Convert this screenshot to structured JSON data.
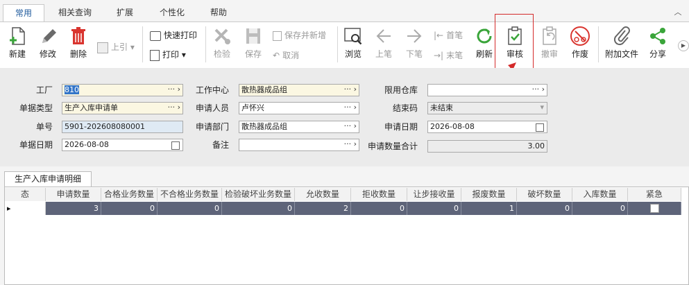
{
  "menu_tabs": [
    "常用",
    "相关查询",
    "扩展",
    "个性化",
    "帮助"
  ],
  "toolbar": {
    "new": "新建",
    "edit": "修改",
    "delete": "删除",
    "pull": "上引",
    "quick_print": "快速打印",
    "print": "打印",
    "inspect": "检验",
    "save": "保存",
    "save_new": "保存并新增",
    "cancel": "取消",
    "browse": "浏览",
    "prev": "上笔",
    "next": "下笔",
    "first": "首笔",
    "last": "末笔",
    "refresh": "刷新",
    "audit": "审核",
    "unaudit": "撤审",
    "void": "作废",
    "attach": "附加文件",
    "share": "分享"
  },
  "form": {
    "factory_label": "工厂",
    "factory_value": "810",
    "doc_type_label": "单据类型",
    "doc_type_value": "生产入库申请单",
    "doc_no_label": "单号",
    "doc_no_value": "5901-202608080001",
    "doc_date_label": "单据日期",
    "doc_date_value": "2026-08-08",
    "work_center_label": "工作中心",
    "work_center_value": "散热器成品组",
    "applicant_label": "申请人员",
    "applicant_value": "卢怀兴",
    "dept_label": "申请部门",
    "dept_value": "散热器成品组",
    "remark_label": "备注",
    "remark_value": "",
    "warehouse_label": "限用仓库",
    "warehouse_value": "",
    "close_code_label": "结束码",
    "close_code_value": "未结束",
    "apply_date_label": "申请日期",
    "apply_date_value": "2026-08-08",
    "qty_total_label": "申请数量合计",
    "qty_total_value": "3.00",
    "lookup_glyph": "··· ›"
  },
  "grid": {
    "tab_label": "生产入库申请明细",
    "columns": [
      "态",
      "申请数量",
      "合格业务数量",
      "不合格业务数量",
      "检验破坏业务数量",
      "允收数量",
      "拒收数量",
      "让步接收量",
      "报废数量",
      "破坏数量",
      "入库数量",
      "紧急"
    ],
    "row": [
      "",
      "3",
      "0",
      "0",
      "0",
      "2",
      "0",
      "0",
      "1",
      "0",
      "0",
      ""
    ]
  }
}
